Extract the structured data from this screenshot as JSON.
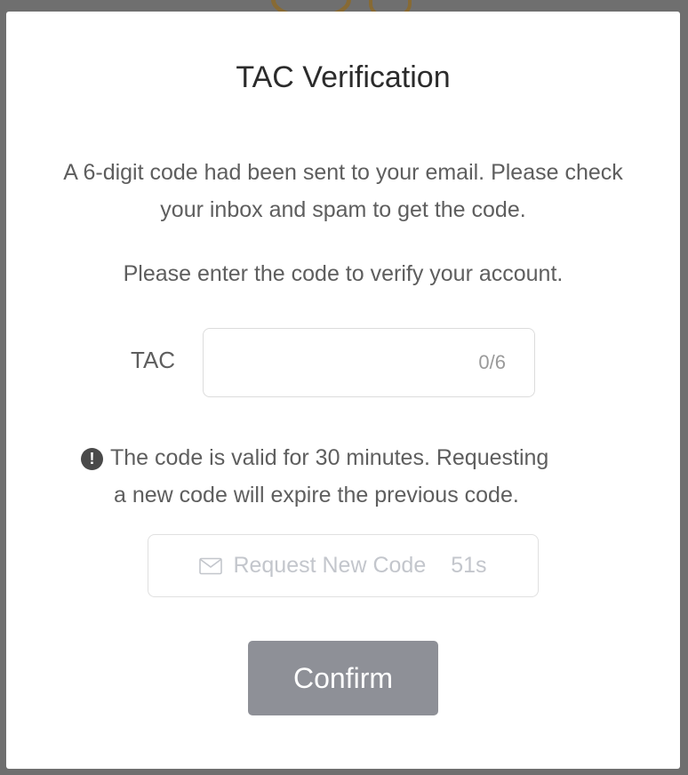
{
  "modal": {
    "title": "TAC Verification",
    "description": "A 6-digit code had been sent to your email. Please check your inbox and spam to get the code.",
    "instruction": "Please enter the code to verify your account.",
    "tac_field": {
      "label": "TAC",
      "value": "",
      "placeholder": "",
      "counter": "0/6"
    },
    "notice": {
      "icon": "exclamation-circle-icon",
      "line1": "The code is valid for 30 minutes. Requesting",
      "line2": "a new code will expire the previous code."
    },
    "request_button": {
      "icon": "mail-icon",
      "label": "Request New Code",
      "countdown": "51s",
      "disabled_color": "#c3c6cc"
    },
    "confirm_button": {
      "label": "Confirm",
      "color": "#8e9097"
    }
  }
}
